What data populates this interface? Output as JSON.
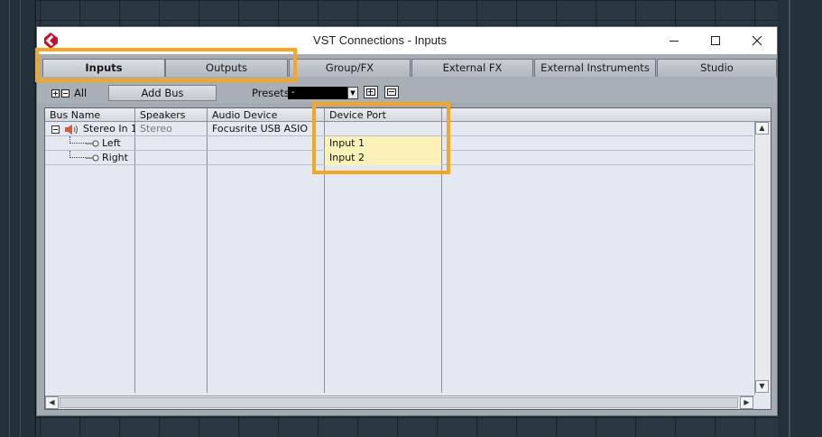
{
  "window": {
    "title": "VST Connections - Inputs"
  },
  "tabs": [
    {
      "label": "Inputs",
      "active": true
    },
    {
      "label": "Outputs",
      "active": false
    },
    {
      "label": "Group/FX",
      "active": false
    },
    {
      "label": "External FX",
      "active": false
    },
    {
      "label": "External Instruments",
      "active": false
    },
    {
      "label": "Studio",
      "active": false
    }
  ],
  "toolbar": {
    "all_label": "All",
    "add_bus_label": "Add Bus",
    "presets_label": "Presets",
    "presets_value": "-"
  },
  "table": {
    "columns": [
      "Bus Name",
      "Speakers",
      "Audio Device",
      "Device Port"
    ],
    "rows": [
      {
        "bus_name": "Stereo In 1",
        "speakers": "Stereo",
        "audio_device": "Focusrite USB ASIO",
        "device_port": ""
      },
      {
        "bus_name": "Left",
        "speakers": "",
        "audio_device": "",
        "device_port": "Input 1"
      },
      {
        "bus_name": "Right",
        "speakers": "",
        "audio_device": "",
        "device_port": "Input 2"
      }
    ]
  },
  "colors": {
    "highlight_annotation": "#f5a623",
    "port_cell_highlight": "#fcf1b9",
    "logo_red": "#c8102e"
  },
  "icons": {
    "app_logo": "cubase-logo-icon",
    "speaker": "speaker-icon",
    "channel": "plug-connector-icon"
  }
}
